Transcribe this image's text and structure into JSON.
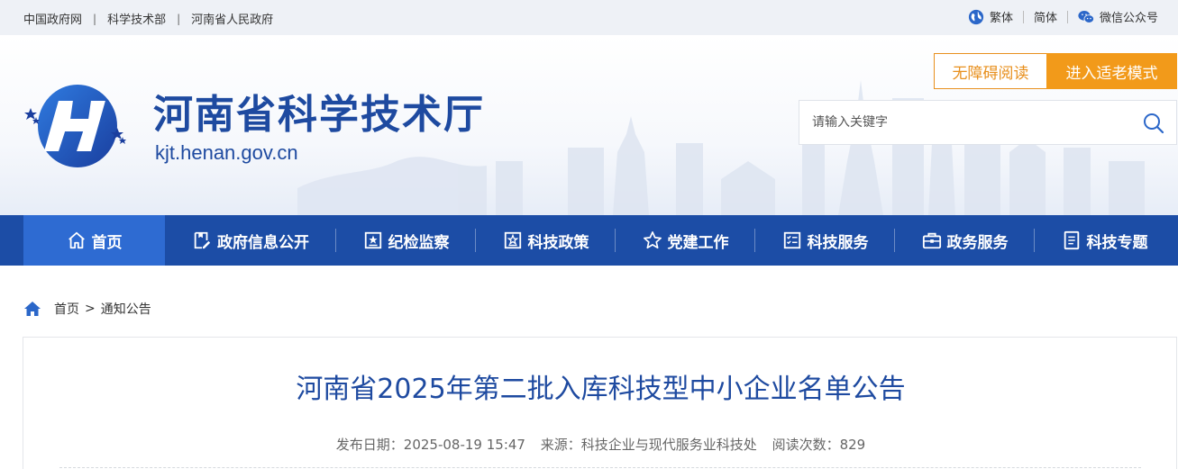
{
  "topbar": {
    "links": [
      "中国政府网",
      "科学技术部",
      "河南省人民政府"
    ],
    "lang_traditional": "繁体",
    "lang_simplified": "简体",
    "wechat": "微信公众号"
  },
  "header": {
    "site_title": "河南省科学技术厅",
    "domain": "kjt.henan.gov.cn",
    "accessibility_btn": "无障碍阅读",
    "elder_mode_btn": "进入适老模式",
    "search_placeholder": "请输入关键字"
  },
  "nav": {
    "items": [
      {
        "label": "首页",
        "icon": "home-icon",
        "active": true
      },
      {
        "label": "政府信息公开",
        "icon": "document-icon"
      },
      {
        "label": "纪检监察",
        "icon": "badge-icon"
      },
      {
        "label": "科技政策",
        "icon": "policy-icon"
      },
      {
        "label": "党建工作",
        "icon": "star-icon"
      },
      {
        "label": "科技服务",
        "icon": "checklist-icon"
      },
      {
        "label": "政务服务",
        "icon": "briefcase-icon"
      },
      {
        "label": "科技专题",
        "icon": "list-doc-icon"
      }
    ]
  },
  "breadcrumb": {
    "home": "首页",
    "separator": ">",
    "current": "通知公告"
  },
  "article": {
    "title": "河南省2025年第二批入库科技型中小企业名单公告",
    "publish_date_label": "发布日期：",
    "publish_date": "2025-08-19 15:47",
    "source_label": "来源：",
    "source": "科技企业与现代服务业科技处",
    "views_label": "阅读次数：",
    "views": "829"
  },
  "colors": {
    "primary_blue": "#1c4da6",
    "active_nav": "#2e6bd2",
    "title_blue": "#1e4aa0",
    "orange": "#f29a1a"
  }
}
